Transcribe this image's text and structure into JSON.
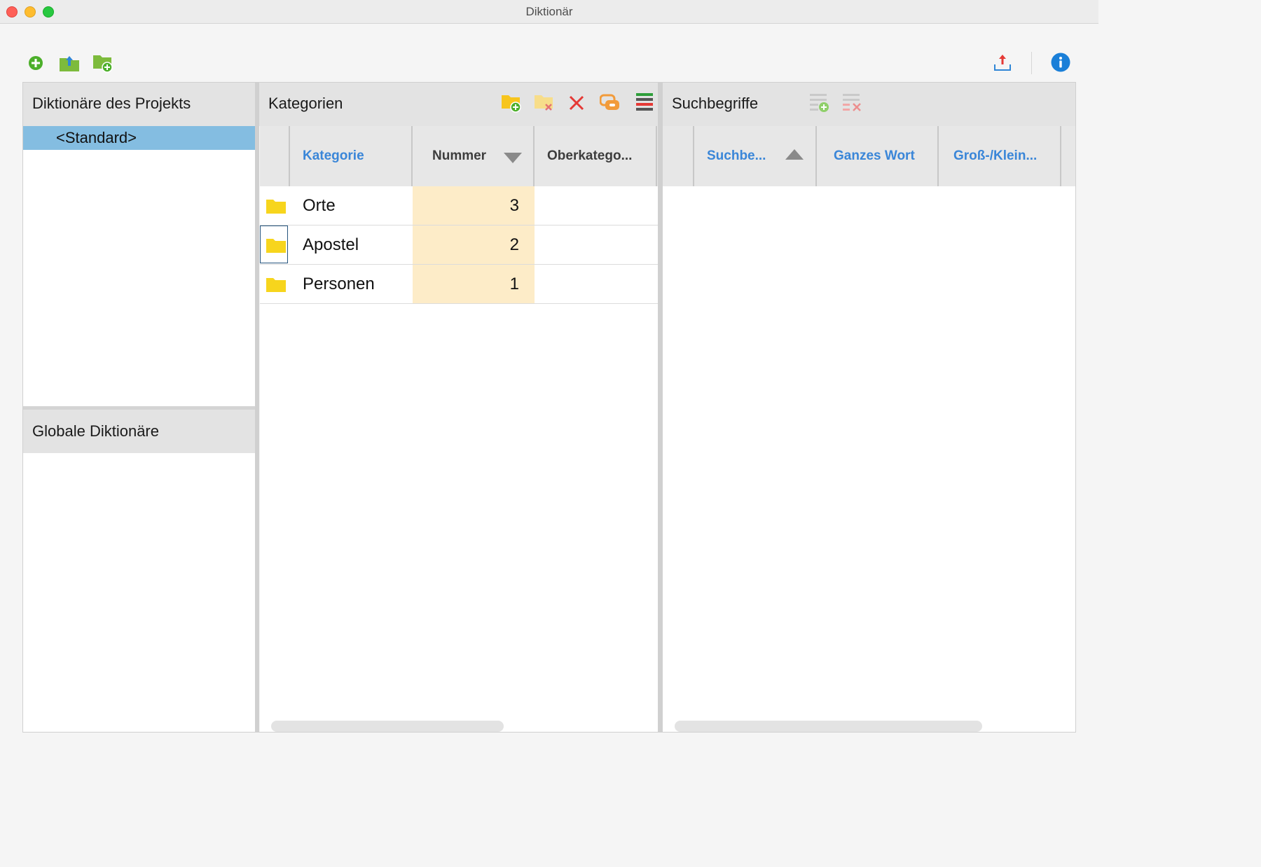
{
  "window": {
    "title": "Diktionär"
  },
  "toolbar": {
    "left_icons": [
      "add-circle-icon",
      "import-folder-icon",
      "new-folder-icon"
    ],
    "right_icons": [
      "export-icon",
      "info-icon"
    ]
  },
  "project_panel": {
    "header": "Diktionäre des Projekts",
    "items": [
      "<Standard>"
    ]
  },
  "global_panel": {
    "header": "Globale Diktionäre"
  },
  "categories_panel": {
    "header": "Kategorien",
    "columns": [
      {
        "label": "Kategorie",
        "sorted": false
      },
      {
        "label": "Nummer",
        "sorted": "descending"
      },
      {
        "label": "Oberkatego..."
      }
    ],
    "rows": [
      {
        "name": "Orte",
        "number": "3"
      },
      {
        "name": "Apostel",
        "number": "2"
      },
      {
        "name": "Personen",
        "number": "1"
      }
    ],
    "icons": [
      "new-category-icon",
      "delete-category-icon",
      "delete-icon",
      "link-icon",
      "color-list-icon"
    ]
  },
  "terms_panel": {
    "header": "Suchbegriffe",
    "columns": [
      {
        "label": "Suchbe...",
        "sorted": "ascending"
      },
      {
        "label": "Ganzes Wort"
      },
      {
        "label": "Groß-/Klein..."
      }
    ],
    "icons": [
      "add-term-icon",
      "remove-term-icon"
    ]
  },
  "colors": {
    "accent_blue": "#3a86d8",
    "selection": "#84bde1",
    "highlight_column": "#fdecc8",
    "folder_yellow": "#f7d51d"
  }
}
